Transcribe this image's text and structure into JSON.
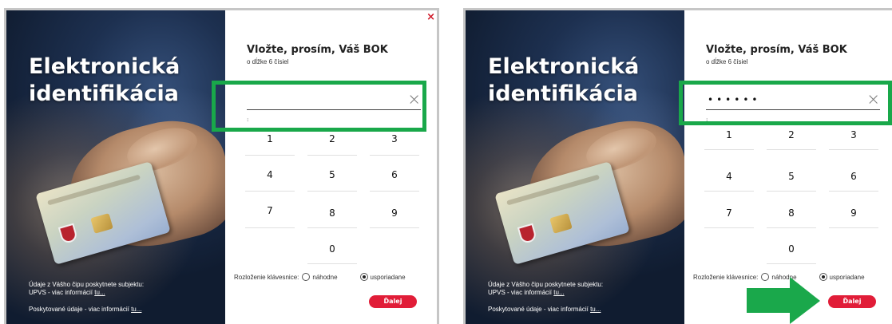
{
  "headline_line1": "Elektronická",
  "headline_line2": "identifikácia",
  "info": {
    "line1": "Údaje z Vášho čipu poskytnete subjektu:",
    "line2_prefix": "UPVS - viac informácií",
    "line2_link": "tu...",
    "line3_prefix": "Poskytované údaje - viac informácií",
    "line3_link": "tu..."
  },
  "form": {
    "close_glyph": "×",
    "title": "Vložte, prosím, Váš BOK",
    "subtitle": "o dĺžke 6 čísiel",
    "clear_glyph": "×",
    "colon": ":",
    "layout_label": "Rozloženie klávesnice:",
    "option_random": "náhodne",
    "option_ordered": "usporiadane",
    "next_label": "Ďalej"
  },
  "screens": [
    {
      "pin_value": "",
      "keys": [
        "1",
        "2",
        "3",
        "4",
        "5",
        "6",
        "7",
        "8",
        "9",
        "0"
      ]
    },
    {
      "pin_value": "••••••",
      "keys": [
        "1",
        "2",
        "3",
        "4",
        "5",
        "6",
        "7",
        "8",
        "9",
        "0"
      ]
    }
  ],
  "colors": {
    "highlight": "#19a84a",
    "accent_red": "#e11d38",
    "arrow_green": "#1aa84b"
  }
}
